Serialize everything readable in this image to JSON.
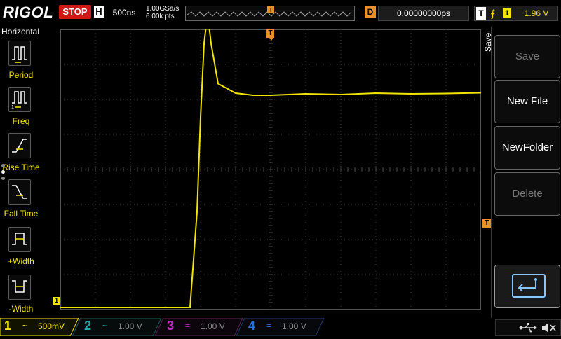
{
  "brand": "RIGOL",
  "run_state": "STOP",
  "timebase": {
    "label": "H",
    "value": "500ns"
  },
  "sample": {
    "rate": "1.00GSa/s",
    "points": "6.00k pts"
  },
  "delay": {
    "label": "D",
    "value": "0.00000000ps"
  },
  "trigger": {
    "label": "T",
    "edge_icon": "rising-edge-icon",
    "edge_glyph": "⨍",
    "source": "1",
    "level": "1.96 V"
  },
  "left_menu": {
    "title": "Horizontal",
    "items": [
      {
        "label": "Period",
        "icon": "period-icon"
      },
      {
        "label": "Freq",
        "icon": "freq-icon"
      },
      {
        "label": "Rise Time",
        "icon": "rise-time-icon"
      },
      {
        "label": "Fall Time",
        "icon": "fall-time-icon"
      },
      {
        "label": "+Width",
        "icon": "positive-width-icon"
      },
      {
        "label": "-Width",
        "icon": "negative-width-icon"
      }
    ]
  },
  "right_menu": {
    "title": "Save",
    "buttons": [
      {
        "label": "Save",
        "enabled": false
      },
      {
        "label": "New File",
        "enabled": true
      },
      {
        "label": "NewFolder",
        "enabled": true
      },
      {
        "label": "Delete",
        "enabled": false
      }
    ],
    "back_icon": "return-arrow-icon"
  },
  "channels": [
    {
      "num": "1",
      "coupling": "~",
      "value": "500mV",
      "color": "#f2e600",
      "active": true
    },
    {
      "num": "2",
      "coupling": "~",
      "value": "1.00 V",
      "color": "#1fa6a6",
      "active": false
    },
    {
      "num": "3",
      "coupling": "=",
      "value": "1.00 V",
      "color": "#c22fc2",
      "active": false
    },
    {
      "num": "4",
      "coupling": "=",
      "value": "1.00 V",
      "color": "#2a6ed6",
      "active": false
    }
  ],
  "markers": {
    "trigger_pos": "T",
    "trigger_level": "T",
    "ch1_ground": "1"
  },
  "colors": {
    "ch1": "#f2e600",
    "trigger_orange": "#e8912a",
    "stop_red": "#d01818",
    "grid": "#3c3c3c"
  },
  "status_icons": [
    "usb-icon",
    "speaker-muted-icon"
  ],
  "chart_data": {
    "type": "line",
    "title": "",
    "xlabel": "",
    "ylabel": "",
    "series": [
      {
        "x": [
          0,
          0.5,
          1.0,
          1.5,
          2.0,
          2.5,
          3.0,
          3.3,
          3.5,
          3.7,
          3.9,
          4.0,
          4.1,
          4.2,
          4.3,
          4.5,
          5.0,
          5.5,
          6.0,
          7.0,
          8.0,
          9.0,
          10.0,
          11.0,
          12.0
        ],
        "y": [
          -3.94,
          -3.94,
          -3.94,
          -3.94,
          -3.94,
          -3.94,
          -3.94,
          -3.94,
          -3.94,
          -3.94,
          -1.2,
          1.5,
          3.6,
          4.45,
          3.6,
          2.45,
          2.18,
          2.12,
          2.12,
          2.16,
          2.14,
          2.18,
          2.16,
          2.17,
          2.19
        ]
      }
    ],
    "xlim": [
      0,
      12
    ],
    "ylim": [
      -4,
      4
    ],
    "grid": true
  }
}
